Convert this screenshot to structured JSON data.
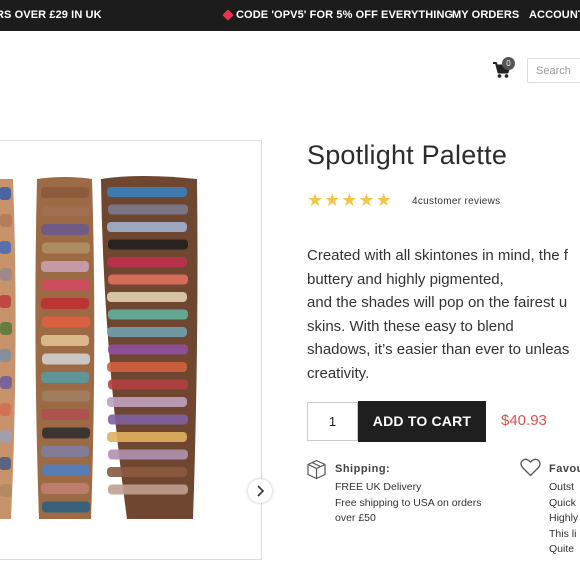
{
  "topbar": {
    "left_text": "RS OVER £29 IN UK",
    "promo_code": "CODE 'OPV5' FOR 5% OFF EVERYTHING",
    "orders": "MY ORDERS",
    "account": "ACCOUNT"
  },
  "header": {
    "cart_count": "0",
    "search_placeholder": "Search"
  },
  "product": {
    "title": "Spotlight Palette",
    "rating": 5,
    "reviews_text": "4customer reviews",
    "description_lines": [
      "Created with all skintones in mind, the f",
      "buttery and highly pigmented,",
      "and the shades will pop on the fairest u",
      "skins. With these easy to blend",
      "shadows, it’s easier than ever to unleas",
      "creativity."
    ],
    "quantity": "1",
    "add_to_cart": "ADD TO CART",
    "price": "$40.93"
  },
  "shipping": {
    "title": "Shipping:",
    "lines": [
      "FREE UK Delivery",
      "Free shipping to USA on orders",
      "over £50"
    ]
  },
  "favourite": {
    "title": "Favou",
    "lines": [
      "Outst",
      "Quick",
      "Highly",
      "This li",
      "Quite"
    ]
  },
  "colors": {
    "topbar_bg": "#1c1c1c",
    "star": "#f4c54a",
    "price": "#d9534f",
    "button_bg": "#1f1f1f"
  }
}
